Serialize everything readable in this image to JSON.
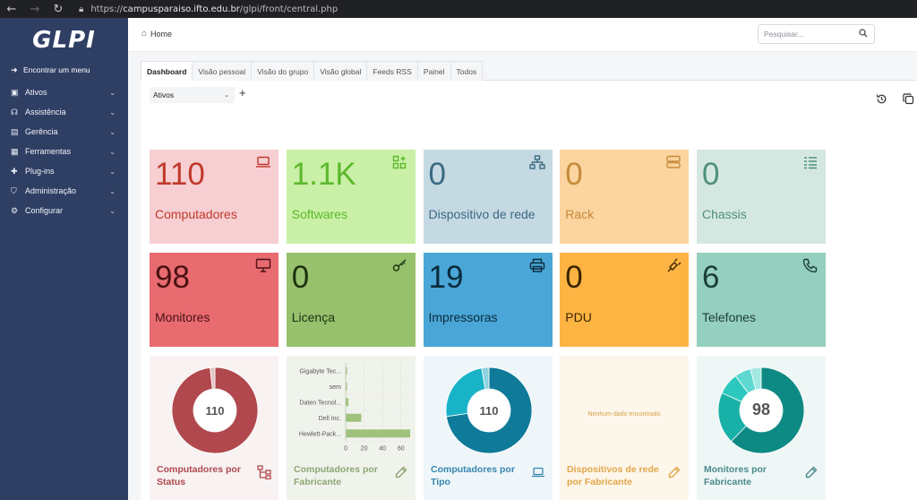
{
  "browser": {
    "url_prefix": "https://",
    "url_host": "campusparaiso.ifto.edu.br",
    "url_path": "/glpi/front/central.php"
  },
  "sidebar": {
    "logo": "GLPI",
    "find_menu": "Encontrar um menu",
    "items": [
      {
        "label": "Ativos",
        "icon": "box-icon"
      },
      {
        "label": "Assistência",
        "icon": "headset-icon"
      },
      {
        "label": "Gerência",
        "icon": "wallet-icon"
      },
      {
        "label": "Ferramentas",
        "icon": "briefcase-icon"
      },
      {
        "label": "Plug-ins",
        "icon": "puzzle-icon"
      },
      {
        "label": "Administração",
        "icon": "shield-icon"
      },
      {
        "label": "Configurar",
        "icon": "gear-icon"
      }
    ]
  },
  "header": {
    "breadcrumb": "Home",
    "search_placeholder": "Pesquisar..."
  },
  "tabs": [
    "Dashboard",
    "Visão pessoal",
    "Visão do grupo",
    "Visão global",
    "Feeds RSS",
    "Painel",
    "Todos"
  ],
  "dashboard": {
    "selected": "Ativos"
  },
  "cards": [
    {
      "value": "110",
      "label": "Computadores",
      "bg": "#f7cfd2",
      "fg": "#c0392b",
      "icon": "laptop-icon"
    },
    {
      "value": "1.1K",
      "label": "Softwares",
      "bg": "#c9f0a6",
      "fg": "#5cb82c",
      "icon": "apps-add-icon"
    },
    {
      "value": "0",
      "label": "Dispositivo de rede",
      "bg": "#c5d9e3",
      "fg": "#3b6a82",
      "icon": "network-icon"
    },
    {
      "value": "0",
      "label": "Rack",
      "bg": "#fbd49f",
      "fg": "#c68a3a",
      "icon": "server-icon"
    },
    {
      "value": "0",
      "label": "Chassis",
      "bg": "#d4e8e1",
      "fg": "#4f8f7e",
      "icon": "list-icon"
    },
    {
      "value": "98",
      "label": "Monitores",
      "bg": "#e86b70",
      "fg": "#4a1113",
      "icon": "monitor-icon"
    },
    {
      "value": "0",
      "label": "Licença",
      "bg": "#97c16d",
      "fg": "#1e3210",
      "icon": "key-icon"
    },
    {
      "value": "19",
      "label": "Impressoras",
      "bg": "#49a6d6",
      "fg": "#0b2a3b",
      "icon": "printer-icon"
    },
    {
      "value": "0",
      "label": "PDU",
      "bg": "#fdb443",
      "fg": "#3b2500",
      "icon": "plug-icon"
    },
    {
      "value": "6",
      "label": "Telefones",
      "bg": "#95cfbf",
      "fg": "#1b3f35",
      "icon": "phone-icon"
    }
  ],
  "widgets": {
    "computers_status": {
      "title": "Computadores por Status",
      "center": "110",
      "slices": [
        108,
        2
      ],
      "colors": [
        "#b0484d",
        "#e5c4c5"
      ],
      "bg": "#f8f2f2",
      "fg": "#b0484d",
      "icon": "hierarchy-icon"
    },
    "computers_manufacturer": {
      "title": "Computadores por Fabricante",
      "bg": "#f0f3ec",
      "fg": "#8ea673",
      "icon": "edit-icon",
      "chart_data": {
        "type": "bar",
        "categories": [
          "Gigabyte Tec...",
          "sem",
          "Daten Tecnol...",
          "Dell Inc.",
          "Hewlett-Pack..."
        ],
        "values": [
          1,
          1,
          3,
          17,
          70
        ],
        "xlim": [
          0,
          70
        ],
        "xticks": [
          "0",
          "20",
          "40",
          "60"
        ],
        "xtick_values": [
          0,
          20,
          40,
          60
        ],
        "bar_color": "#9fc27c"
      }
    },
    "computers_type": {
      "title": "Computadores por Tipo",
      "center": "110",
      "slices": [
        80,
        27,
        3
      ],
      "colors": [
        "#0f7a99",
        "#19b3c8",
        "#8fd2e0"
      ],
      "bg": "#eef6f9",
      "fg": "#3785b0",
      "icon": "laptop-icon"
    },
    "network_manufacturer": {
      "title": "Dispositivos de rede por Fabricante",
      "nodata": "Nenhum dado encontrado",
      "bg": "#fdf6ea",
      "fg": "#e2a74c",
      "icon": "edit-icon"
    },
    "monitors_manufacturer": {
      "title": "Monitores por Fabricante",
      "center": "98",
      "slices": [
        61,
        19,
        8,
        6,
        4
      ],
      "colors": [
        "#0e8a84",
        "#19b0a8",
        "#2cc8be",
        "#5dd8d0",
        "#a4e8e3"
      ],
      "bg": "#eff6f6",
      "fg": "#4a8a8c",
      "icon": "edit-icon"
    }
  }
}
